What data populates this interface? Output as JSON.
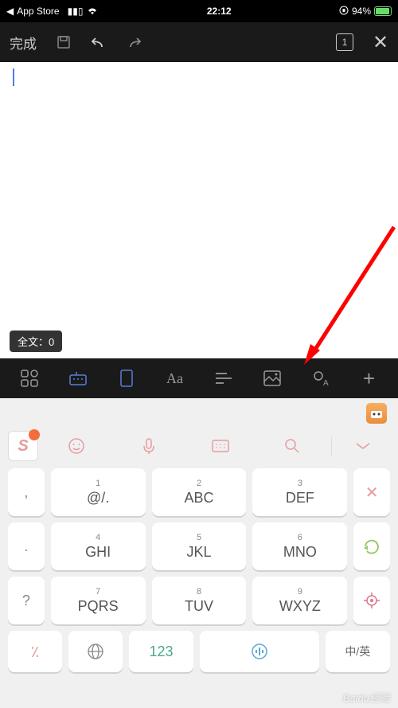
{
  "status": {
    "back_app": "App Store",
    "time": "22:12",
    "battery_pct": "94%"
  },
  "toolbar": {
    "done": "完成",
    "page_count": "1"
  },
  "editor": {
    "word_count_label": "全文：",
    "word_count_value": "0"
  },
  "keyboard": {
    "keys": [
      {
        "num": "1",
        "label": "@/."
      },
      {
        "num": "2",
        "label": "ABC"
      },
      {
        "num": "3",
        "label": "DEF"
      },
      {
        "num": "4",
        "label": "GHI"
      },
      {
        "num": "5",
        "label": "JKL"
      },
      {
        "num": "6",
        "label": "MNO"
      },
      {
        "num": "7",
        "label": "PQRS"
      },
      {
        "num": "8",
        "label": "TUV"
      },
      {
        "num": "9",
        "label": "WXYZ"
      }
    ],
    "side_left": [
      ",",
      ".",
      "?",
      "!"
    ],
    "num_key": "123",
    "lang_key": "中/英"
  },
  "watermark": "Baidu经验"
}
